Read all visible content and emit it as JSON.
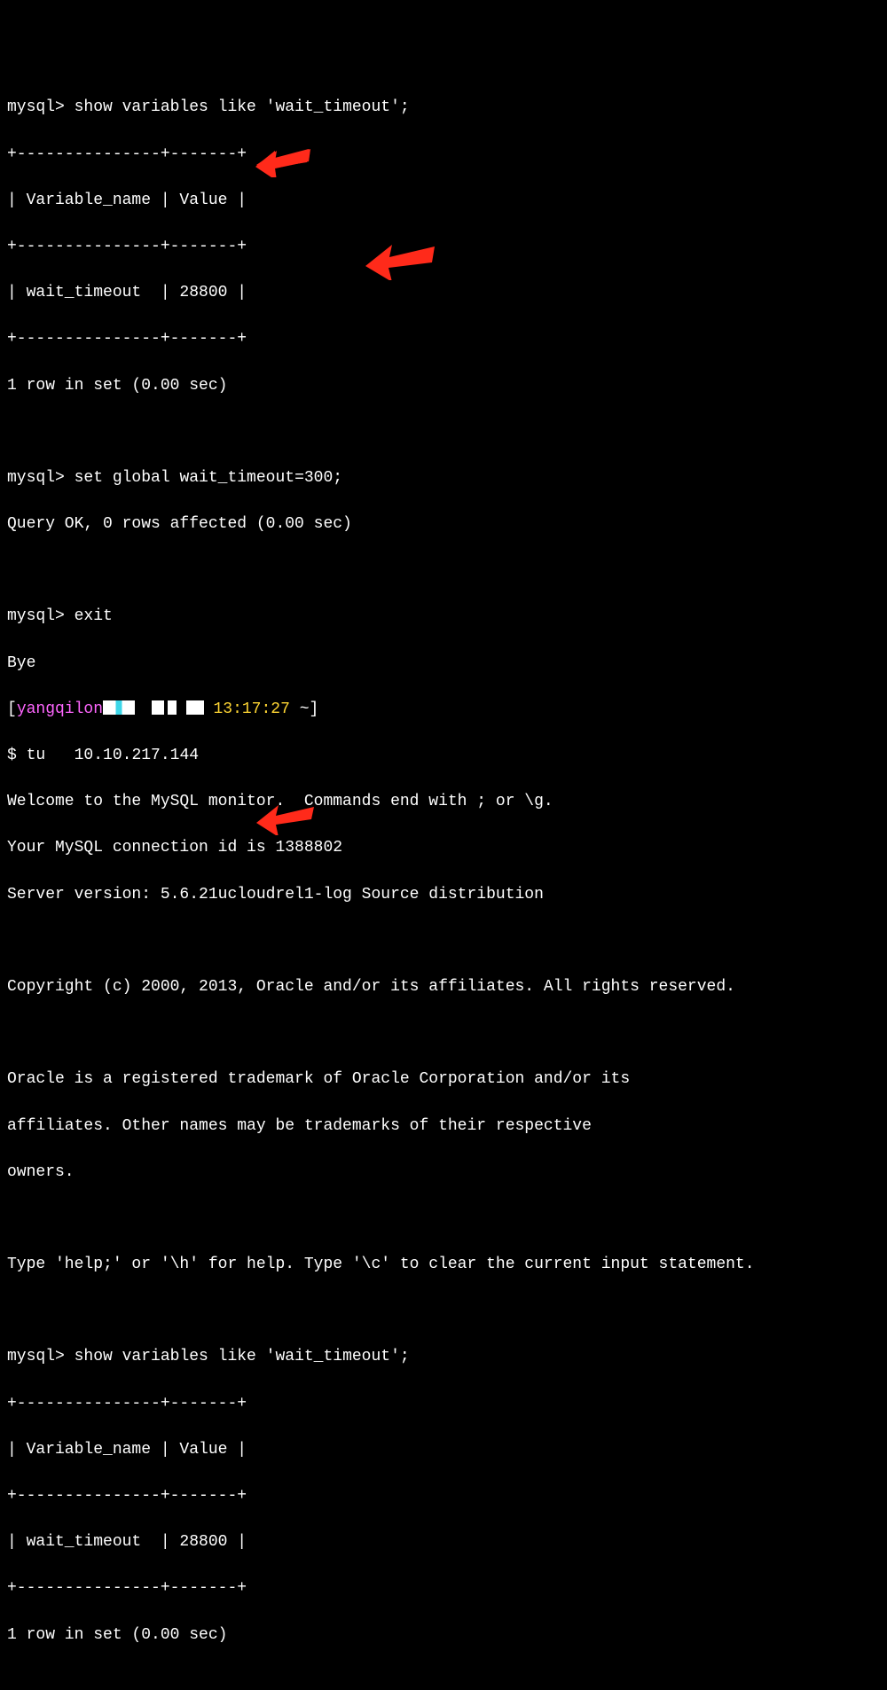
{
  "mysql_prompt": "mysql>",
  "cmd1": "show variables like 'wait_timeout';",
  "table_border": "+---------------+-------+",
  "table_header": "| Variable_name | Value |",
  "table_row1": "| wait_timeout  | 28800 |",
  "row_summary": "1 row in set (0.00 sec)",
  "cmd2": "set global wait_timeout=300;",
  "query_ok": "Query OK, 0 rows affected (0.00 sec)",
  "cmd3": "exit",
  "bye": "Bye",
  "shell_user": "yangqilon",
  "shell_time": "13:17:27",
  "shell_path": "~",
  "shell_prompt": "$",
  "shell_cmd": "tu   10.10.217.144",
  "welcome1": "Welcome to the MySQL monitor.  Commands end with ; or \\g.",
  "welcome2": "Your MySQL connection id is 1388802",
  "welcome3": "Server version: 5.6.21ucloudrel1-log Source distribution",
  "copyright": "Copyright (c) 2000, 2013, Oracle and/or its affiliates. All rights reserved.",
  "legal1": "Oracle is a registered trademark of Oracle Corporation and/or its",
  "legal2": "affiliates. Other names may be trademarks of their respective",
  "legal3": "owners.",
  "help_line": "Type 'help;' or '\\h' for help. Type '\\c' to clear the current input statement.",
  "cmd4": "show variables like 'wait_timeout';"
}
